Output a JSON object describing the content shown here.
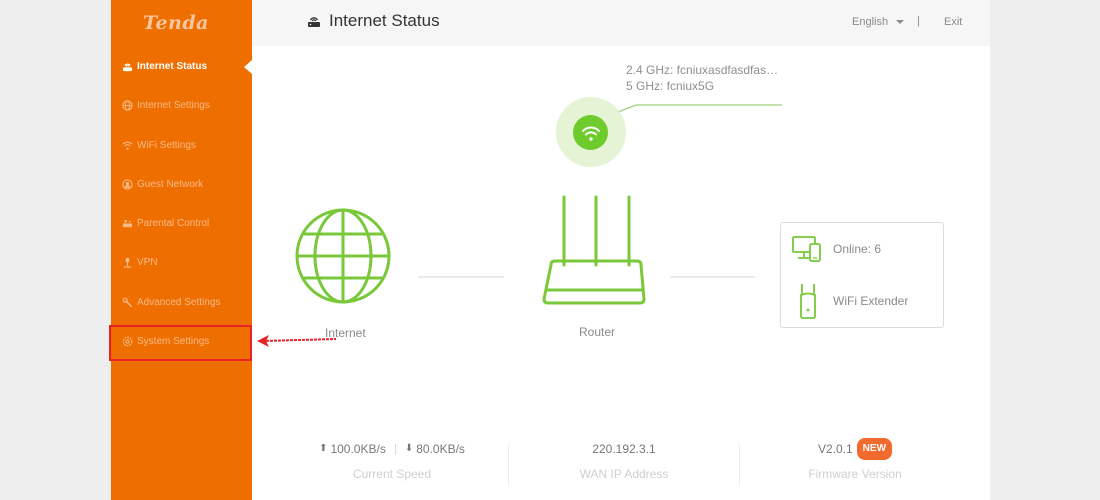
{
  "brand": {
    "logo": "Tenda",
    "accent": "#ee6f00"
  },
  "sidebar": {
    "items": [
      {
        "label": "Internet Status",
        "icon": "router-icon",
        "active": true
      },
      {
        "label": "Internet Settings",
        "icon": "globe-icon"
      },
      {
        "label": "WiFi Settings",
        "icon": "wifi-icon"
      },
      {
        "label": "Guest Network",
        "icon": "guest-icon"
      },
      {
        "label": "Parental Control",
        "icon": "parental-icon"
      },
      {
        "label": "VPN",
        "icon": "vpn-icon"
      },
      {
        "label": "Advanced Settings",
        "icon": "wrench-icon"
      },
      {
        "label": "System Settings",
        "icon": "gear-icon"
      }
    ]
  },
  "header": {
    "title": "Internet Status",
    "language": "English",
    "separator": "|",
    "exit": "Exit"
  },
  "wifi": {
    "ssid_24": "2.4 GHz: fcniuxasdfasdfas…",
    "ssid_5": "5 GHz: fcniux5G"
  },
  "topology": {
    "internet_label": "Internet",
    "router_label": "Router",
    "online_label": "Online:  6",
    "extender_label": "WiFi Extender"
  },
  "stats": {
    "upload": "100.0KB/s",
    "download": "80.0KB/s",
    "speed_label": "Current Speed",
    "wan_ip": "220.192.3.1",
    "wan_label": "WAN IP Address",
    "firmware": "V2.0.1",
    "new_badge": "NEW",
    "firmware_label": "Firmware Version"
  },
  "annotation": {
    "highlight_target": "System Settings",
    "color": "#e8222a"
  }
}
